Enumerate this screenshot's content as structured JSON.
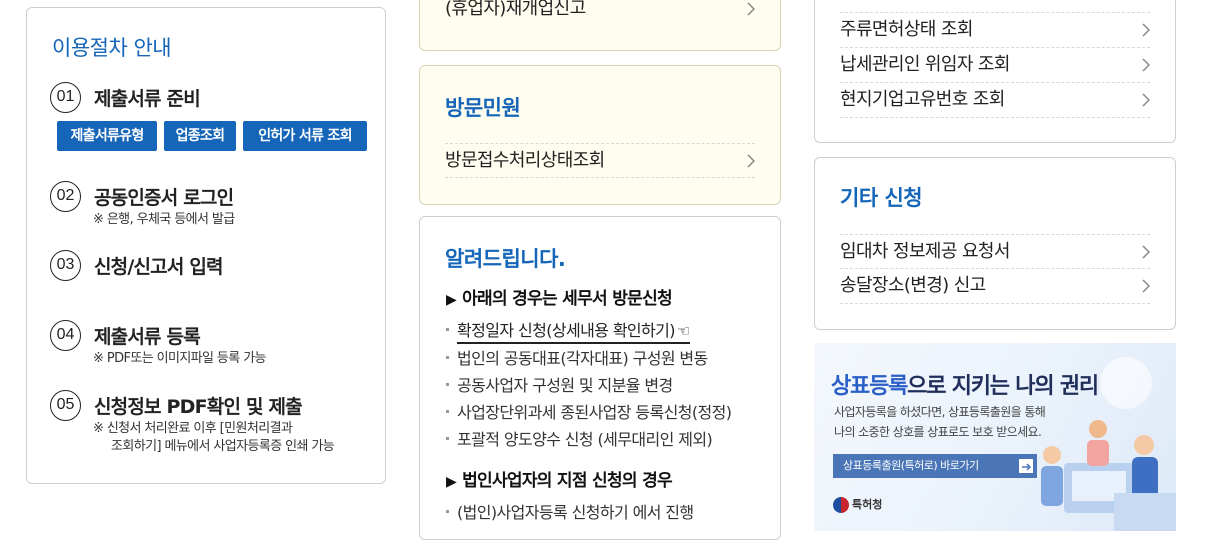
{
  "guide": {
    "title": "이용절차 안내",
    "steps": [
      {
        "num": "01",
        "label": "제출서류 준비"
      },
      {
        "num": "02",
        "label": "공동인증서 로그인",
        "note": "※ 은행, 우체국 등에서 발급"
      },
      {
        "num": "03",
        "label": "신청/신고서 입력"
      },
      {
        "num": "04",
        "label": "제출서류 등록",
        "note": "※ PDF또는 이미지파일 등록 가능"
      },
      {
        "num": "05",
        "label": "신청정보 PDF확인 및 제출",
        "note_line1": "※ 신청서 처리완료 이후 [민원처리결과",
        "note_line2": "조회하기] 메뉴에서 사업자등록증 인쇄 가능"
      }
    ],
    "buttons": [
      "제출서류유형",
      "업종조회",
      "인허가 서류 조회"
    ]
  },
  "reopen": {
    "item": "(휴업자)재개업신고"
  },
  "visit": {
    "title": "방문민원",
    "item": "방문접수처리상태조회"
  },
  "notice": {
    "title": "알려드립니다.",
    "section1": "아래의 경우는 세무서 방문신청",
    "items": [
      "확정일자 신청(상세내용 확인하기)",
      "법인의 공동대표(각자대표) 구성원 변동",
      "공동사업자 구성원 및 지분율 변경",
      "사업장단위과세 종된사업장 등록신청(정정)",
      "포괄적 양도양수 신청 (세무대리인 제외)"
    ],
    "section2": "법인사업자의 지점 신청의 경우",
    "items2": [
      "(법인)사업자등록 신청하기 에서 진행"
    ]
  },
  "rtop": {
    "items": [
      "주류면허상태 조회",
      "납세관리인 위임자 조회",
      "현지기업고유번호 조회"
    ]
  },
  "etc": {
    "title": "기타 신청",
    "items": [
      "임대차 정보제공 요청서",
      "송달장소(변경) 신고"
    ]
  },
  "banner": {
    "title_highlight": "상표등록",
    "title_rest": "으로 지키는 나의 권리",
    "desc_line1": "사업자등록을 하셨다면, 상표등록출원을 통해",
    "desc_line2": "나의 소중한 상호를 상표로도 보호 받으세요.",
    "button": "상표등록출원(특허로) 바로가기",
    "logo": "특허청"
  },
  "colors": {
    "accent": "#1565b9",
    "button": "#1566b8",
    "panel_yellow": "#fffdf0"
  }
}
